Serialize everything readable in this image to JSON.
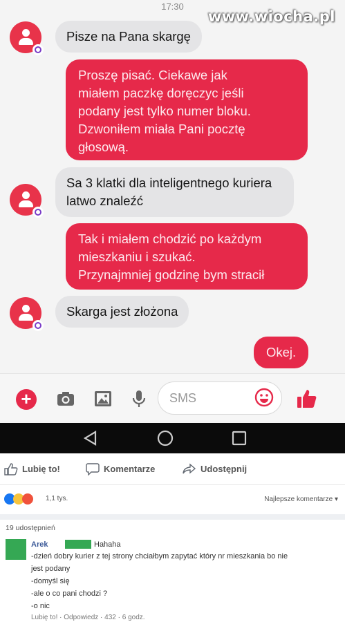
{
  "status": {
    "time": "17:30"
  },
  "watermark": "www.wiocha.pl",
  "colors": {
    "accent": "#e6294a",
    "incoming_bubble": "#e4e4e6",
    "fb_link": "#3b5998"
  },
  "messages": [
    {
      "direction": "in",
      "text": "Pisze na Pana skargę"
    },
    {
      "direction": "out",
      "text": "Proszę pisać. Ciekawe jak\nmiałem paczkę doręczyc jeśli\npodany jest tylko numer bloku.\nDzwoniłem miała Pani pocztę\ngłosową."
    },
    {
      "direction": "in",
      "text": "Sa 3 klatki dla inteligentnego kuriera latwo znaleźć"
    },
    {
      "direction": "out",
      "text": "Tak i miałem chodzić po każdym\nmieszkaniu i szukać.\nPrzynajmniej godzinę bym stracił"
    },
    {
      "direction": "in",
      "text": "Skarga jest złożona"
    },
    {
      "direction": "out",
      "text": "Okej."
    }
  ],
  "composer": {
    "placeholder": "SMS",
    "icons": [
      "plus-icon",
      "camera-icon",
      "gallery-icon",
      "microphone-icon",
      "emoji-icon",
      "thumbs-up-icon"
    ]
  },
  "navbar": {
    "icons": [
      "back-icon",
      "home-icon",
      "recents-icon"
    ]
  },
  "facebook": {
    "actions": {
      "like": "Lubię to!",
      "comment": "Komentarze",
      "share": "Udostępnij"
    },
    "reactions_count": "1,1 tys.",
    "sort_label": "Najlepsze komentarze",
    "shares": "19 udostępnień",
    "comment": {
      "author": "Arek",
      "first_line": "Hahaha",
      "lines": [
        "-dzień dobry kurier z tej strony chciałbym zapytać który nr mieszkania bo nie",
        "jest podany",
        "-domyśl się",
        "-ale o co pani chodzi ?",
        "-o nic"
      ],
      "footer": "Lubię to! · Odpowiedz · 432 · 6 godz."
    }
  }
}
